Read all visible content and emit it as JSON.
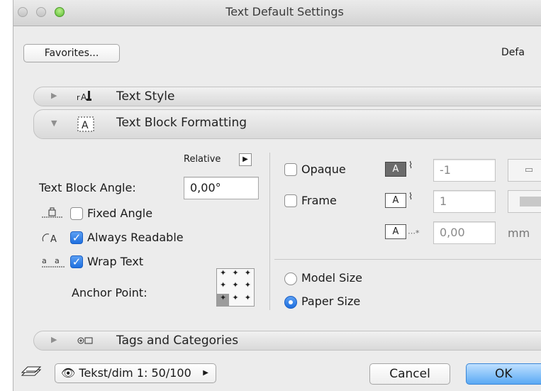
{
  "window": {
    "title": "Text Default Settings"
  },
  "toolbar": {
    "favorites_label": "Favorites...",
    "default_label": "Defa"
  },
  "sections": {
    "text_style": "Text Style",
    "text_block_formatting": "Text Block Formatting",
    "tags_and_categories": "Tags and Categories"
  },
  "formatting": {
    "relative_label": "Relative",
    "angle_label": "Text Block Angle:",
    "angle_value": "0,00°",
    "fixed_angle": {
      "label": "Fixed Angle",
      "checked": false
    },
    "always_readable": {
      "label": "Always Readable",
      "checked": true
    },
    "wrap_text": {
      "label": "Wrap Text",
      "checked": true
    },
    "anchor_label": "Anchor Point:",
    "opaque": {
      "label": "Opaque",
      "checked": false
    },
    "frame": {
      "label": "Frame",
      "checked": false
    },
    "opaque_pen_value": "-1",
    "frame_pen_value": "1",
    "offset_value": "0,00",
    "unit": "mm",
    "model_size": {
      "label": "Model Size",
      "selected": false
    },
    "paper_size": {
      "label": "Paper Size",
      "selected": true
    }
  },
  "bottom": {
    "layer_value": "Tekst/dim 1: 50/100",
    "cancel_label": "Cancel",
    "ok_label": "OK"
  },
  "colors": {
    "accent": "#1e6fdf",
    "window_bg": "#ececec"
  },
  "icons": [
    "text-style-icon",
    "text-block-icon",
    "tags-icon",
    "layer-icon",
    "eye-icon",
    "fixed-angle-icon",
    "readable-icon",
    "wrap-icon"
  ]
}
